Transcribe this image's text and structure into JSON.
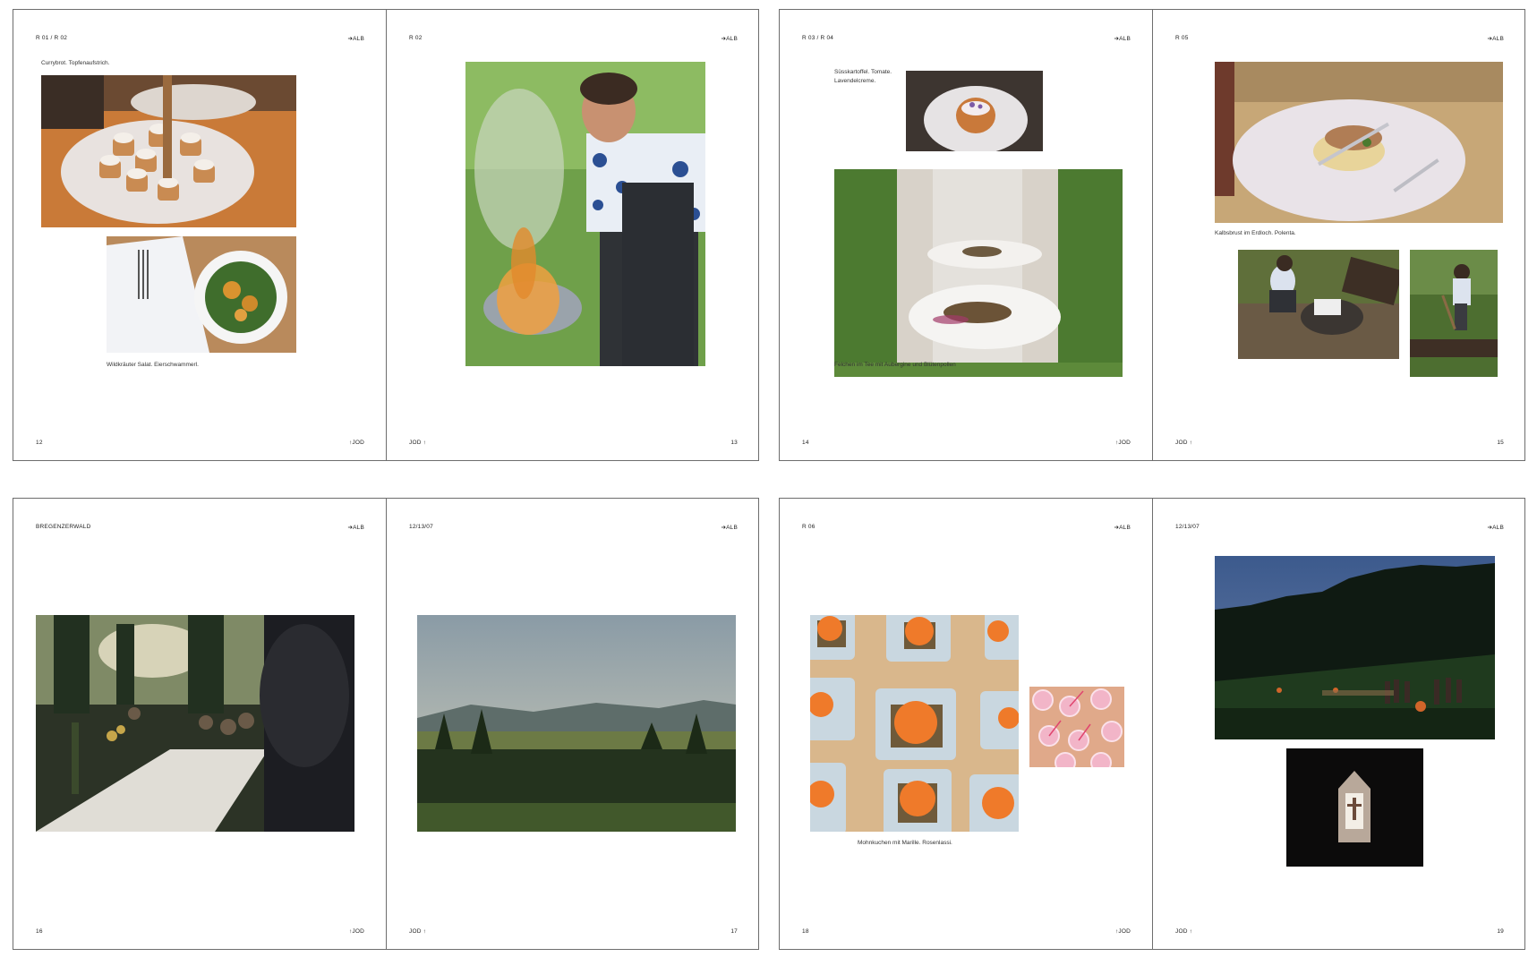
{
  "spreads": [
    {
      "left": {
        "header": "R 01 / R 02",
        "marker": "➔ALB",
        "folio": "12",
        "footer_mark": "↑JOD",
        "captions": {
          "top": "Currybrot. Topfenaufstrich.",
          "bottom": "Wildkräuter Salat. Eierschwammerl."
        }
      },
      "right": {
        "header": "R 02",
        "marker": "➔ALB",
        "folio": "13",
        "footer_mark": "JOD ↑"
      }
    },
    {
      "left": {
        "header": "R 03 / R 04",
        "marker": "➔ALB",
        "folio": "14",
        "footer_mark": "↑JOD",
        "captions": {
          "top": "Süsskartoffel. Tomate. Lavendelcreme.",
          "bottom": "Felchen im Tee mit Aubergine und Blütenpollen"
        }
      },
      "right": {
        "header": "R 05",
        "marker": "➔ALB",
        "folio": "15",
        "footer_mark": "JOD ↑",
        "captions": {
          "mid": "Kalbsbrust im Erdloch. Polenta."
        }
      }
    },
    {
      "left": {
        "header": "BREGENZERWALD",
        "marker": "➔ALB",
        "folio": "16",
        "footer_mark": "↑JOD"
      },
      "right": {
        "header": "12/13/07",
        "marker": "➔ALB",
        "folio": "17",
        "footer_mark": "JOD ↑"
      }
    },
    {
      "left": {
        "header": "R 06",
        "marker": "➔ALB",
        "folio": "18",
        "footer_mark": "↑JOD",
        "captions": {
          "bottom": "Mohnkuchen mit Marille. Rosenlassi."
        }
      },
      "right": {
        "header": "12/13/07",
        "marker": "➔ALB",
        "folio": "19",
        "footer_mark": "JOD ↑"
      }
    }
  ]
}
